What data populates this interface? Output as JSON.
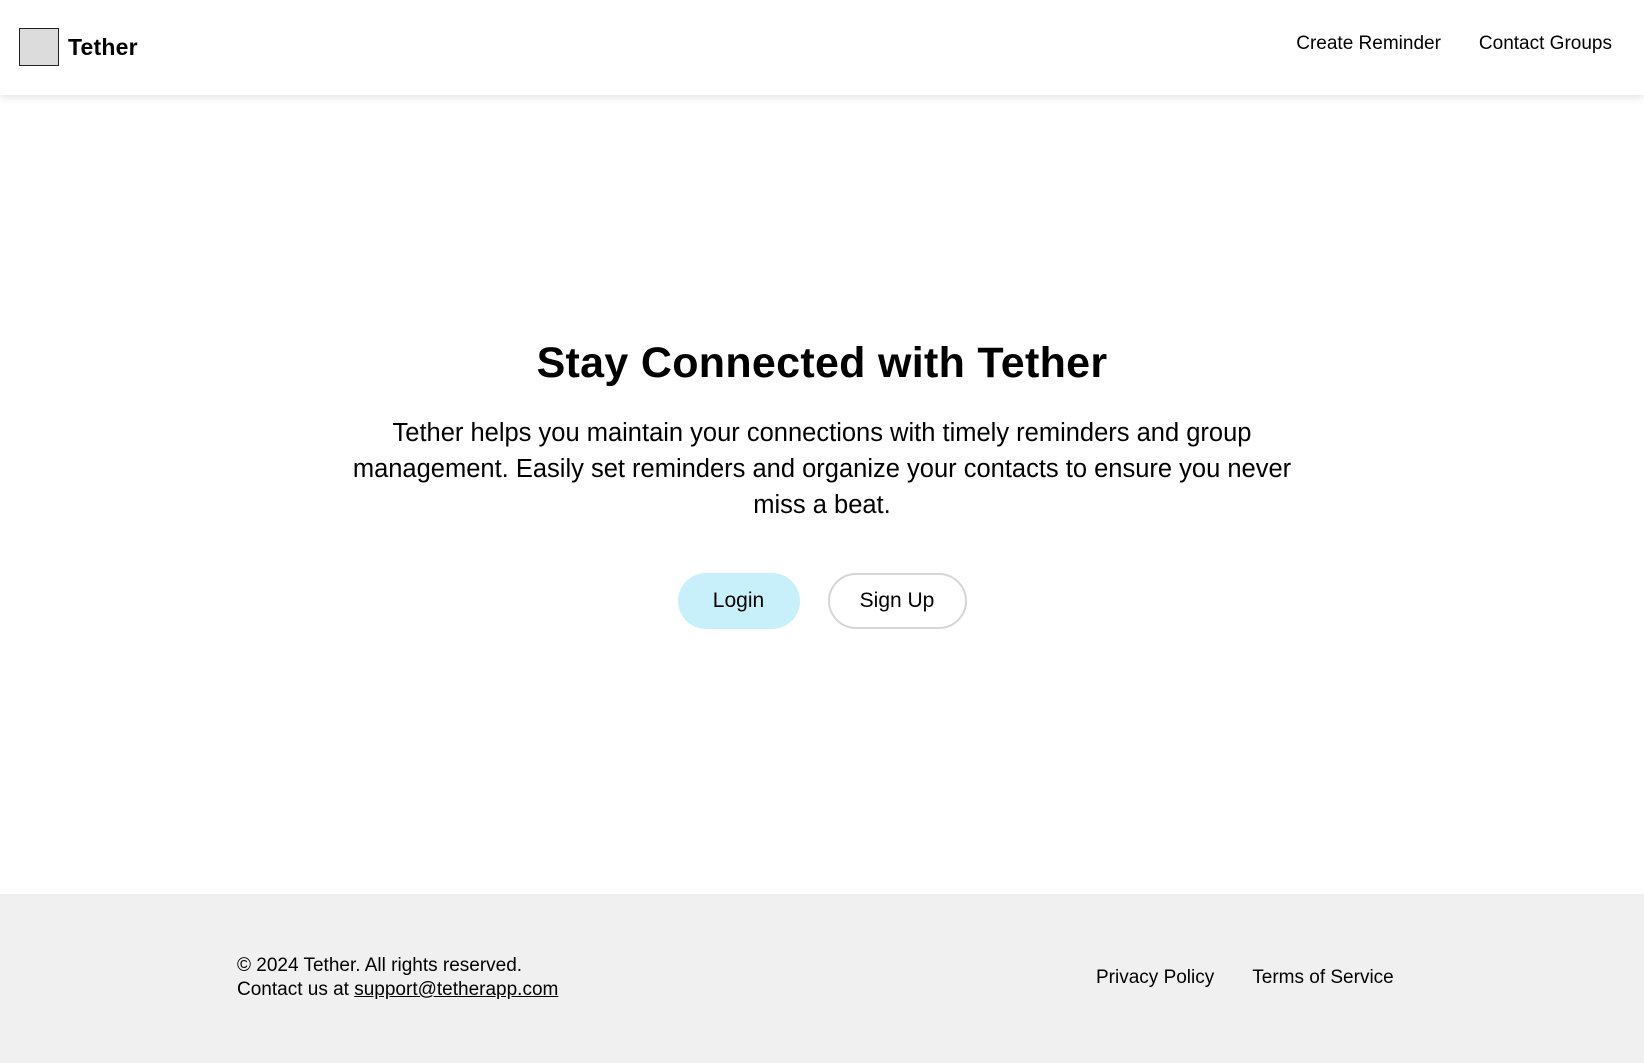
{
  "header": {
    "brand": "Tether",
    "nav": [
      {
        "label": "Create Reminder"
      },
      {
        "label": "Contact Groups"
      }
    ]
  },
  "hero": {
    "title": "Stay Connected with Tether",
    "description": "Tether helps you maintain your connections with timely reminders and group management. Easily set reminders and organize your contacts to ensure you never miss a beat.",
    "login_label": "Login",
    "signup_label": "Sign Up"
  },
  "footer": {
    "copyright": "© 2024 Tether. All rights reserved.",
    "contact_prefix": "Contact us at",
    "contact_email": "support@tetherapp.com",
    "links": [
      {
        "label": "Privacy Policy"
      },
      {
        "label": "Terms of Service"
      }
    ]
  },
  "colors": {
    "login_button_bg": "#c8f0fb",
    "signup_button_border": "#d6d6d6",
    "footer_bg": "#f0f0f0",
    "logo_placeholder_bg": "#dcdcdc"
  },
  "icons": {
    "logo": "logo-placeholder-icon"
  }
}
